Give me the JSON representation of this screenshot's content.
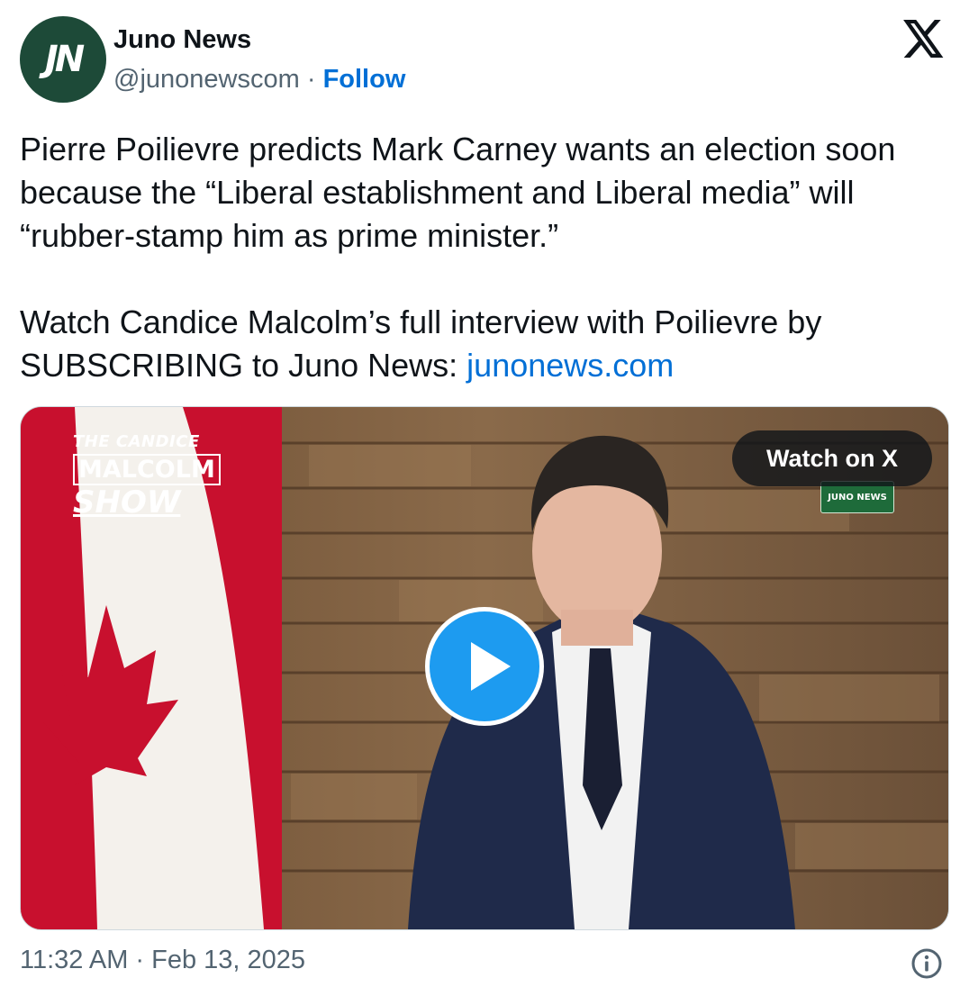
{
  "author": {
    "name": "Juno News",
    "handle": "@junonewscom",
    "separator": "·",
    "follow_label": "Follow",
    "avatar_text": "JN",
    "avatar_color": "#1d4a38"
  },
  "platform_icon": "x-logo-icon",
  "tweet": {
    "paragraph1": "Pierre Poilievre predicts Mark Carney wants an election soon because the “Liberal establishment and Liberal media” will “rubber-stamp him as prime minister.”",
    "paragraph2_prefix": "Watch Candice Malcolm’s full interview with Poilievre by SUBSCRIBING to Juno News: ",
    "link_text": "junonews.com"
  },
  "media": {
    "show_logo": {
      "line1": "THE CANDICE",
      "line2": "MALCOLM",
      "line3": "SHOW"
    },
    "badge_text": "JUNO NEWS",
    "watch_label": "Watch on X",
    "play_icon": "play-icon"
  },
  "footer": {
    "timestamp": "11:32 AM · Feb 13, 2025",
    "info_icon": "info-icon"
  },
  "colors": {
    "link": "#006fd6",
    "play_button": "#1d9bf0",
    "secondary_text": "#536471"
  }
}
